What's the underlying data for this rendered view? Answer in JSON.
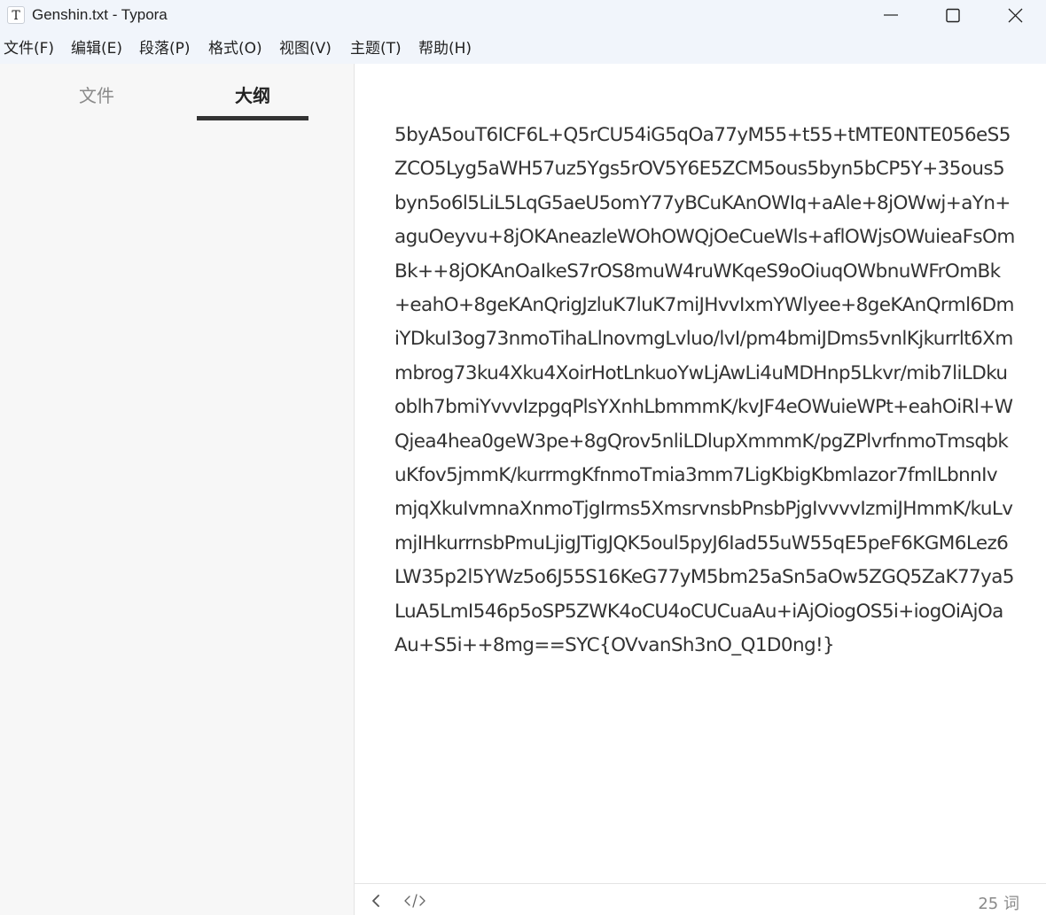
{
  "window": {
    "app_icon_letter": "T",
    "title": "Genshin.txt - Typora"
  },
  "menu": [
    {
      "label": "文件(F)"
    },
    {
      "label": "编辑(E)"
    },
    {
      "label": "段落(P)"
    },
    {
      "label": "格式(O)"
    },
    {
      "label": "视图(V)"
    },
    {
      "label": "主题(T)"
    },
    {
      "label": "帮助(H)"
    }
  ],
  "sidebar": {
    "tabs": [
      {
        "label": "文件",
        "active": false
      },
      {
        "label": "大纲",
        "active": true
      }
    ]
  },
  "editor": {
    "text": "5byA5ouT6ICF6L+Q5rCU54iG5qOa77yM55+t55+tMTE0NTE056eS5ZCO5Lyg5aWH57uz5Ygs5rOV5Y6E5ZCM5ous5byn5bCP5Y+35ous5byn5o6l5LiL5LqG5aeU5omY77yBCuKAnOWIq+aAle+8jOWwj+aYn+aguOeyvu+8jOKAneazleWOhOWQjOeCueWls+aflOWjsOWuieaFsOmBk++8jOKAnOaIkeS7rOS8muW4ruWKqeS9oOiuqOWbnuWFrOmBk+eahO+8geKAnQrigJzluK7luK7miJHvvIxmYWlyee+8geKAnQrml6DmiYDkuI3og73nmoTihaLlnovmgLvluo/lvI/pm4bmiJDms5vnlKjkurrlt6Xmmbrog73ku4Xku4XoirHotLnkuoYwLjAwLi4uMDHnp5Lkvr/mib7liLDkuoblh7bmiYvvvIzpgqPlsYXnhLbmmmK/kvJF4eOWuieWPt+eahOiRl+WQjea4hea0geW3pe+8gQrov5nliLDlupXmmmK/pgZPlvrfnmoTmsqbkuKfov5jmmK/kurrmgKfnmoTmia3mm7LigKbigKbmlazor7fmlLbnnIvmjqXkuIvmnaXnmoTjgIrms5XmsrvnsbPnsbPjgIvvvvIzmiJHmmK/kuLvmjIHkurrnsbPmuLjigJTigJQK5oul5pyJ6Iad55uW55qE5peF6KGM6Lez6LW35p2l5YWz5o6J55S16KeG77yM5bm25aSn5aOw5ZGQ5ZaK77ya5LuA5LmI546p5oSP5ZWK4oCU4oCUCuaAu+iAjOiogOS5i+iogOiAjOaAu+S5i++8mg==SYC{OVvanSh3nO_Q1D0ng!}"
  },
  "statusbar": {
    "word_count": "25 词"
  }
}
